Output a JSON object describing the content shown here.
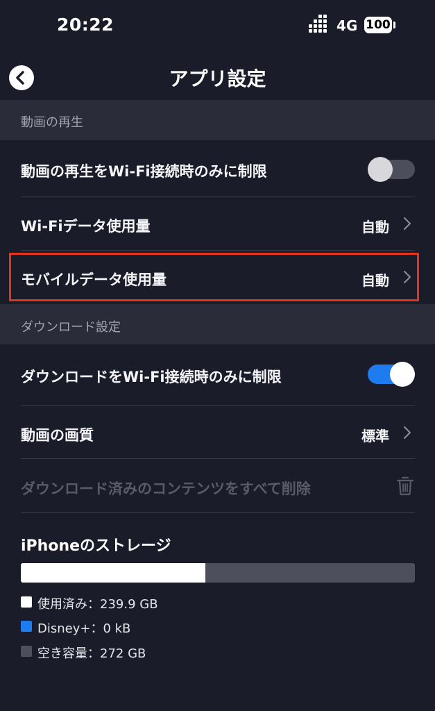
{
  "status_bar": {
    "time": "20:22",
    "network": "4G",
    "battery": "100"
  },
  "nav": {
    "title": "アプリ設定"
  },
  "sections": {
    "playback": {
      "header": "動画の再生",
      "wifi_only_label": "動画の再生をWi-Fi接続時のみに制限",
      "wifi_only_enabled": false,
      "wifi_data_label": "Wi-Fiデータ使用量",
      "wifi_data_value": "自動",
      "mobile_data_label": "モバイルデータ使用量",
      "mobile_data_value": "自動"
    },
    "download": {
      "header": "ダウンロード設定",
      "wifi_only_label": "ダウンロードをWi-Fi接続時のみに制限",
      "wifi_only_enabled": true,
      "quality_label": "動画の画質",
      "quality_value": "標準",
      "delete_all_label": "ダウンロード済みのコンテンツをすべて削除"
    }
  },
  "storage": {
    "title": "iPhoneのストレージ",
    "used_fraction": 0.469,
    "legend": {
      "used": "使用済み：239.9 GB",
      "disney": "Disney+：0 kB",
      "free": "空き容量：272 GB"
    }
  },
  "colors": {
    "background": "#1b1c29",
    "section_header": "#2b2c3a",
    "accent_blue": "#1e7cf0",
    "highlight_red": "#e8321c",
    "free_gray": "#4e4f5c"
  },
  "icons": {
    "back": "chevron-left-circle-icon",
    "chevron": "chevron-right-icon",
    "trash": "trash-icon",
    "signal": "signal-icon",
    "battery": "battery-icon"
  }
}
